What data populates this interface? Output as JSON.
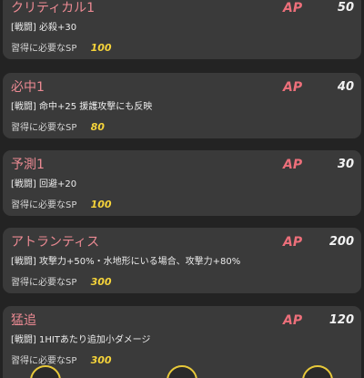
{
  "skills": [
    {
      "name": "クリティカル1",
      "ap_label": "AP",
      "ap": "50",
      "description": "[戦闘] 必殺+30",
      "sp_label": "習得に必要なSP",
      "sp": "100"
    },
    {
      "name": "必中1",
      "ap_label": "AP",
      "ap": "40",
      "description": "[戦闘] 命中+25  援護攻撃にも反映",
      "sp_label": "習得に必要なSP",
      "sp": "80"
    },
    {
      "name": "予測1",
      "ap_label": "AP",
      "ap": "30",
      "description": "[戦闘] 回避+20",
      "sp_label": "習得に必要なSP",
      "sp": "100"
    },
    {
      "name": "アトランティス",
      "ap_label": "AP",
      "ap": "200",
      "description": "[戦闘] 攻撃力+50%・水地形にいる場合、攻撃力+80%",
      "sp_label": "習得に必要なSP",
      "sp": "300"
    },
    {
      "name": "猛追",
      "ap_label": "AP",
      "ap": "120",
      "description": "[戦闘] 1HITあたり追加小ダメージ",
      "sp_label": "習得に必要なSP",
      "sp": "300"
    }
  ],
  "colors": {
    "card_bg": "#3a3a3a",
    "skill_name": "#ec8a93",
    "ap_label": "#ec6f7a",
    "sp_value": "#f5d33a",
    "button_ring": "#e8c93a"
  }
}
